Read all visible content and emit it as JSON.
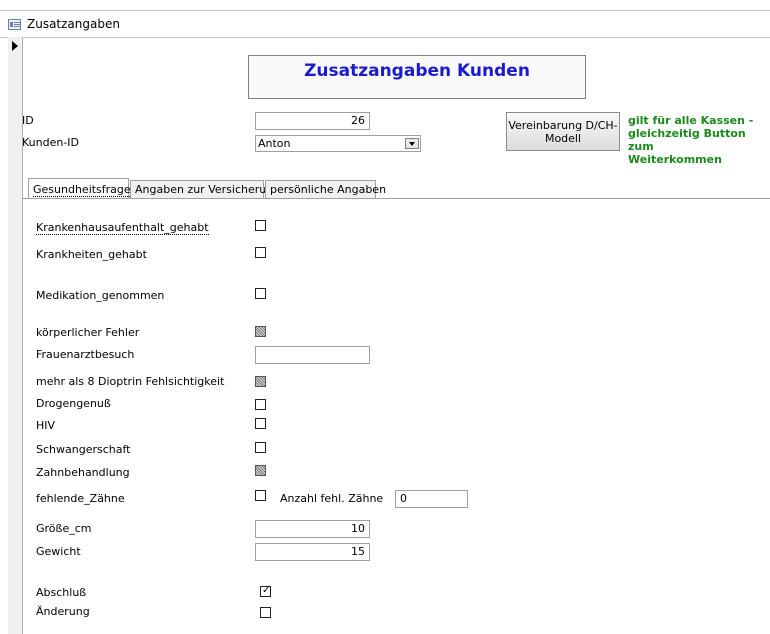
{
  "window": {
    "title": "Zusatzangaben"
  },
  "header": {
    "title": "Zusatzangaben Kunden"
  },
  "fields": {
    "id_label": "ID",
    "id_value": "26",
    "kunden_id_label": "Kunden-ID",
    "kunden_id_value": "Anton"
  },
  "button": {
    "line1": "Vereinbarung D/CH-",
    "line2": "Modell"
  },
  "note": {
    "line1": "gilt für alle Kassen -",
    "line2": "gleichzeitig Button zum",
    "line3": "Weiterkommen"
  },
  "tabs": [
    {
      "label": "Gesundheitsfragen",
      "active": true
    },
    {
      "label": "Angaben zur Versicherung",
      "active": false
    },
    {
      "label": "persönliche Angaben",
      "active": false
    }
  ],
  "questions": {
    "krankenhaus": {
      "label": "Krankenhausaufenthalt_gehabt",
      "state": "unchecked"
    },
    "krankheiten": {
      "label": "Krankheiten_gehabt",
      "state": "unchecked"
    },
    "medikation": {
      "label": "Medikation_genommen",
      "state": "unchecked"
    },
    "koerper": {
      "label": "körperlicher Fehler",
      "state": "indeterminate"
    },
    "frauenarzt": {
      "label": "Frauenarztbesuch",
      "value": ""
    },
    "dioptrin": {
      "label": "mehr als 8 Dioptrin Fehlsichtigkeit",
      "state": "indeterminate"
    },
    "drogen": {
      "label": "Drogengenuß",
      "state": "unchecked"
    },
    "hiv": {
      "label": "HIV",
      "state": "unchecked"
    },
    "schwanger": {
      "label": "Schwangerschaft",
      "state": "unchecked"
    },
    "zahn": {
      "label": "Zahnbehandlung",
      "state": "indeterminate"
    },
    "fehlende": {
      "label": "fehlende_Zähne",
      "state": "unchecked"
    },
    "anzahl": {
      "label": "Anzahl fehl. Zähne",
      "value": "0"
    },
    "groesse": {
      "label": "Größe_cm",
      "value": "10"
    },
    "gewicht": {
      "label": "Gewicht",
      "value": "15"
    },
    "abschluss": {
      "label": "Abschluß",
      "state": "checked"
    },
    "aenderung": {
      "label": "Änderung",
      "state": "unchecked"
    }
  }
}
